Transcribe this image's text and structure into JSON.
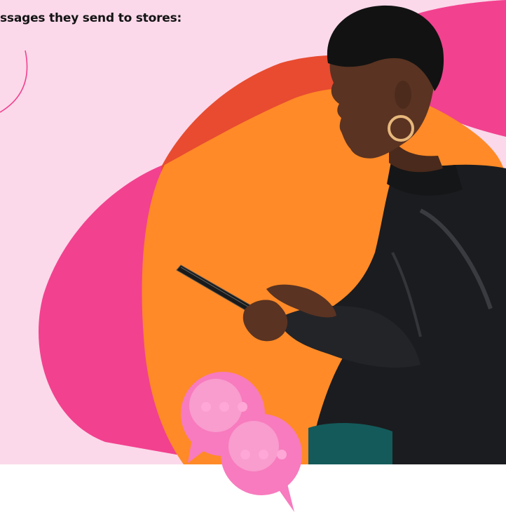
{
  "heading": "ssages they send to stores:",
  "colors": {
    "page_background": "#ffffff",
    "hero_background": "#FBD9EA",
    "blob_pink": "#F2418F",
    "blob_red": "#E84B30",
    "blob_orange": "#FF8A27",
    "skin": "#5A3322",
    "jacket": "#1B1C1F",
    "earring": "#E7B87C",
    "bubble_pink": "#F77BBE"
  },
  "icons": [
    "chat-bubble-icon",
    "typing-dots-icon"
  ]
}
